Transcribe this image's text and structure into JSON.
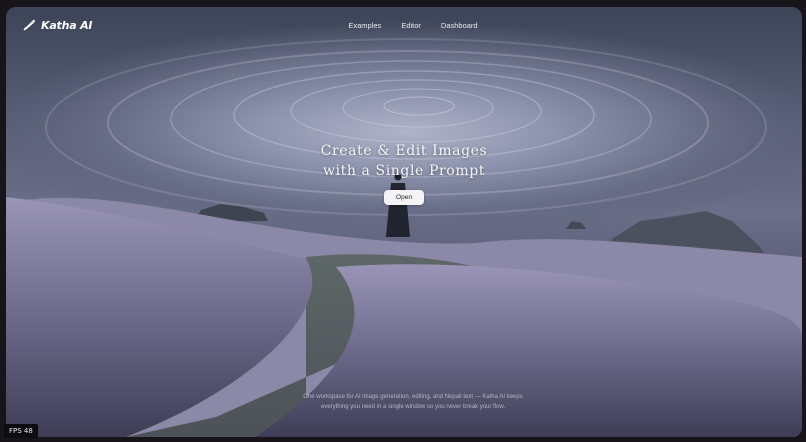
{
  "brand": {
    "name": "Katha AI",
    "logo_icon": "quill-icon"
  },
  "nav": {
    "links": [
      "Examples",
      "Editor",
      "Dashboard"
    ]
  },
  "hero": {
    "headline_line1": "Create & Edit Images",
    "headline_line2": "with a Single Prompt",
    "cta_label": "Open"
  },
  "footer": {
    "tagline": "One workspace for AI image generation, editing, and Nepali text — Katha AI keeps everything you need in a single window so you never break your flow."
  },
  "overlay": {
    "fps_label": "FPS 48"
  },
  "colors": {
    "background": "#17141a",
    "sky": "#5a6077",
    "meadow": "#8a86a6",
    "cta_bg": "#f3f3f5"
  }
}
